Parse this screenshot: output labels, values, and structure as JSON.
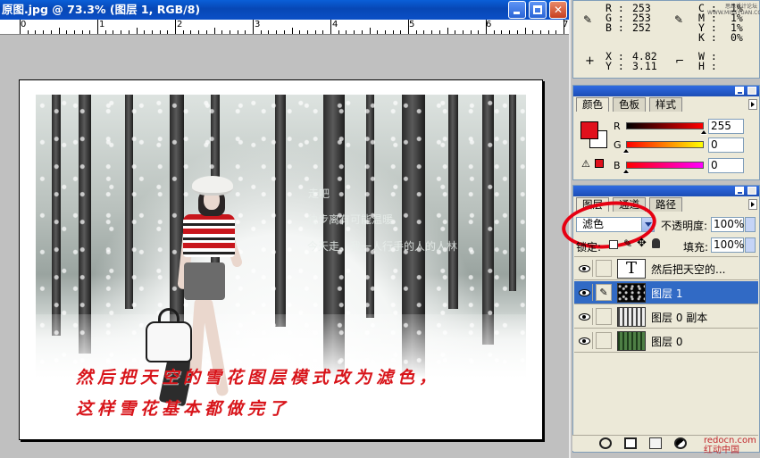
{
  "document": {
    "title": "原图.jpg @ 73.3% (图层 1, RGB/8)",
    "ruler_labels": [
      "0",
      "1",
      "2",
      "3",
      "4",
      "5",
      "6",
      "7"
    ],
    "photo_captions": [
      "走吧",
      "独步离有可能温暖",
      "今天走，我一人行手的人的人林"
    ],
    "overlay_text": [
      "然后把天空的雪花图层模式改为滤色，",
      "这样雪花基本都做完了"
    ]
  },
  "info_panel": {
    "r_label": "R :",
    "r_value": "253",
    "g_label": "G :",
    "g_value": "253",
    "b_label": "B :",
    "b_value": "252",
    "c_label": "C :",
    "c_value": "1%",
    "m_label": "M :",
    "m_value": "1%",
    "y_label": "Y :",
    "y_value": "1%",
    "k_label": "K :",
    "k_value": "0%",
    "x_label": "X :",
    "x_value": "4.82",
    "y2_label": "Y :",
    "y2_value": "3.11",
    "w_label": "W :",
    "h_label": "H :",
    "corner_text": "思缘设计论坛  WWW.MISSYUAN.COM"
  },
  "color_panel": {
    "tabs": [
      "颜色",
      "色板",
      "样式"
    ],
    "foreground_color": "#e0101c",
    "channels": [
      {
        "label": "R",
        "value": "255",
        "level": 1.0
      },
      {
        "label": "G",
        "value": "0",
        "level": 0
      },
      {
        "label": "B",
        "value": "0",
        "level": 0
      }
    ]
  },
  "layers_panel": {
    "tabs": [
      "图层",
      "通道",
      "路径"
    ],
    "blend_mode": "滤色",
    "opacity_label": "不透明度:",
    "opacity_value": "100%",
    "lock_label": "锁定:",
    "fill_label": "填充:",
    "fill_value": "100%",
    "layers": [
      {
        "name": "然后把天空的...",
        "type": "text",
        "selected": false
      },
      {
        "name": "图层 1",
        "type": "pixel",
        "selected": true
      },
      {
        "name": "图层 0 副本",
        "type": "pixel",
        "selected": false
      },
      {
        "name": "图层 0",
        "type": "pixel",
        "selected": false
      }
    ]
  },
  "watermark": {
    "line1": "redocn.com",
    "line2": "红动中国"
  },
  "colors": {
    "titlebar": "#0747b5",
    "selection": "#316ac5",
    "annotation_red": "#e60012"
  }
}
